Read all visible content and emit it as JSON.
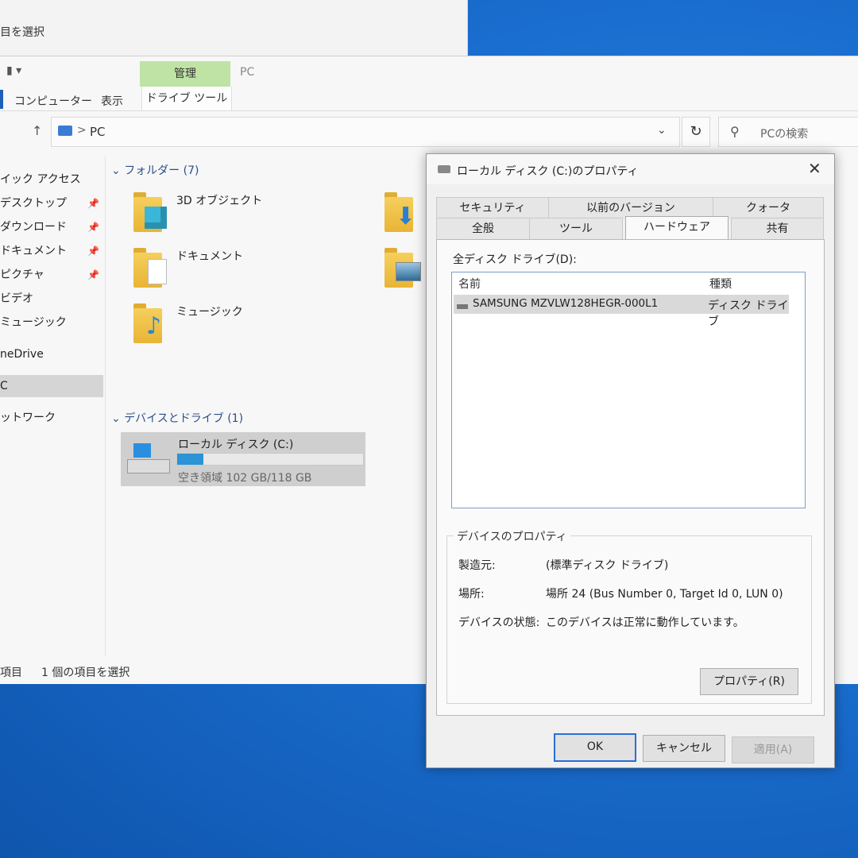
{
  "background_window": {
    "fragment": "目を選択"
  },
  "explorer": {
    "ribbon_tab_manage": "管理",
    "window_title": "PC",
    "ribbon_tabs": [
      "コンピューター",
      "表示",
      "ドライブ ツール"
    ],
    "nav": {
      "up": "↑"
    },
    "address": {
      "separator": ">",
      "location": "PC"
    },
    "search_placeholder": "PCの検索",
    "sidebar": [
      {
        "label": "イック アクセス",
        "pinned": false
      },
      {
        "label": "デスクトップ",
        "pinned": true
      },
      {
        "label": "ダウンロード",
        "pinned": true
      },
      {
        "label": "ドキュメント",
        "pinned": true
      },
      {
        "label": "ピクチャ",
        "pinned": true
      },
      {
        "label": "ビデオ",
        "pinned": false
      },
      {
        "label": "ミュージック",
        "pinned": false
      },
      {
        "label": "neDrive",
        "pinned": false
      },
      {
        "label": "C",
        "pinned": false,
        "selected": true
      },
      {
        "label": "ットワーク",
        "pinned": false
      }
    ],
    "group_folders": "フォルダー (7)",
    "folders": [
      "3D オブジェクト",
      "ドキュメント",
      "ミュージック"
    ],
    "group_devices": "デバイスとドライブ (1)",
    "drive": {
      "name": "ローカル ディスク (C:)",
      "free_text": "空き領域 102 GB/118 GB",
      "used_fraction": 0.14
    },
    "status": {
      "items": "項目",
      "selected": "1 個の項目を選択"
    }
  },
  "dialog": {
    "title": "ローカル ディスク (C:)のプロパティ",
    "tabs_back": [
      "セキュリティ",
      "以前のバージョン",
      "クォータ"
    ],
    "tabs_front": [
      "全般",
      "ツール",
      "ハードウェア",
      "共有"
    ],
    "active_tab": "ハードウェア",
    "all_drives_label": "全ディスク ドライブ(D):",
    "columns": {
      "name": "名前",
      "type": "種類"
    },
    "rows": [
      {
        "name": "SAMSUNG MZVLW128HEGR-000L1",
        "type": "ディスク ドライブ"
      }
    ],
    "device_props_title": "デバイスのプロパティ",
    "props": [
      {
        "key": "製造元:",
        "value": "(標準ディスク ドライブ)"
      },
      {
        "key": "場所:",
        "value": "場所 24 (Bus Number 0, Target Id 0, LUN 0)"
      },
      {
        "key": "デバイスの状態:",
        "value": "このデバイスは正常に動作しています。"
      }
    ],
    "properties_button": "プロパティ(R)",
    "ok": "OK",
    "cancel": "キャンセル",
    "apply": "適用(A)"
  },
  "colors": {
    "desktop": "#1a6ecf",
    "manage_tab": "#bfe3a4",
    "accent": "#2a6fd6",
    "drive_fill": "#2a94d6"
  },
  "icons": [
    "pc-icon",
    "refresh-icon",
    "search-icon",
    "pin-icon",
    "close-icon",
    "folder-icon",
    "drive-icon"
  ]
}
